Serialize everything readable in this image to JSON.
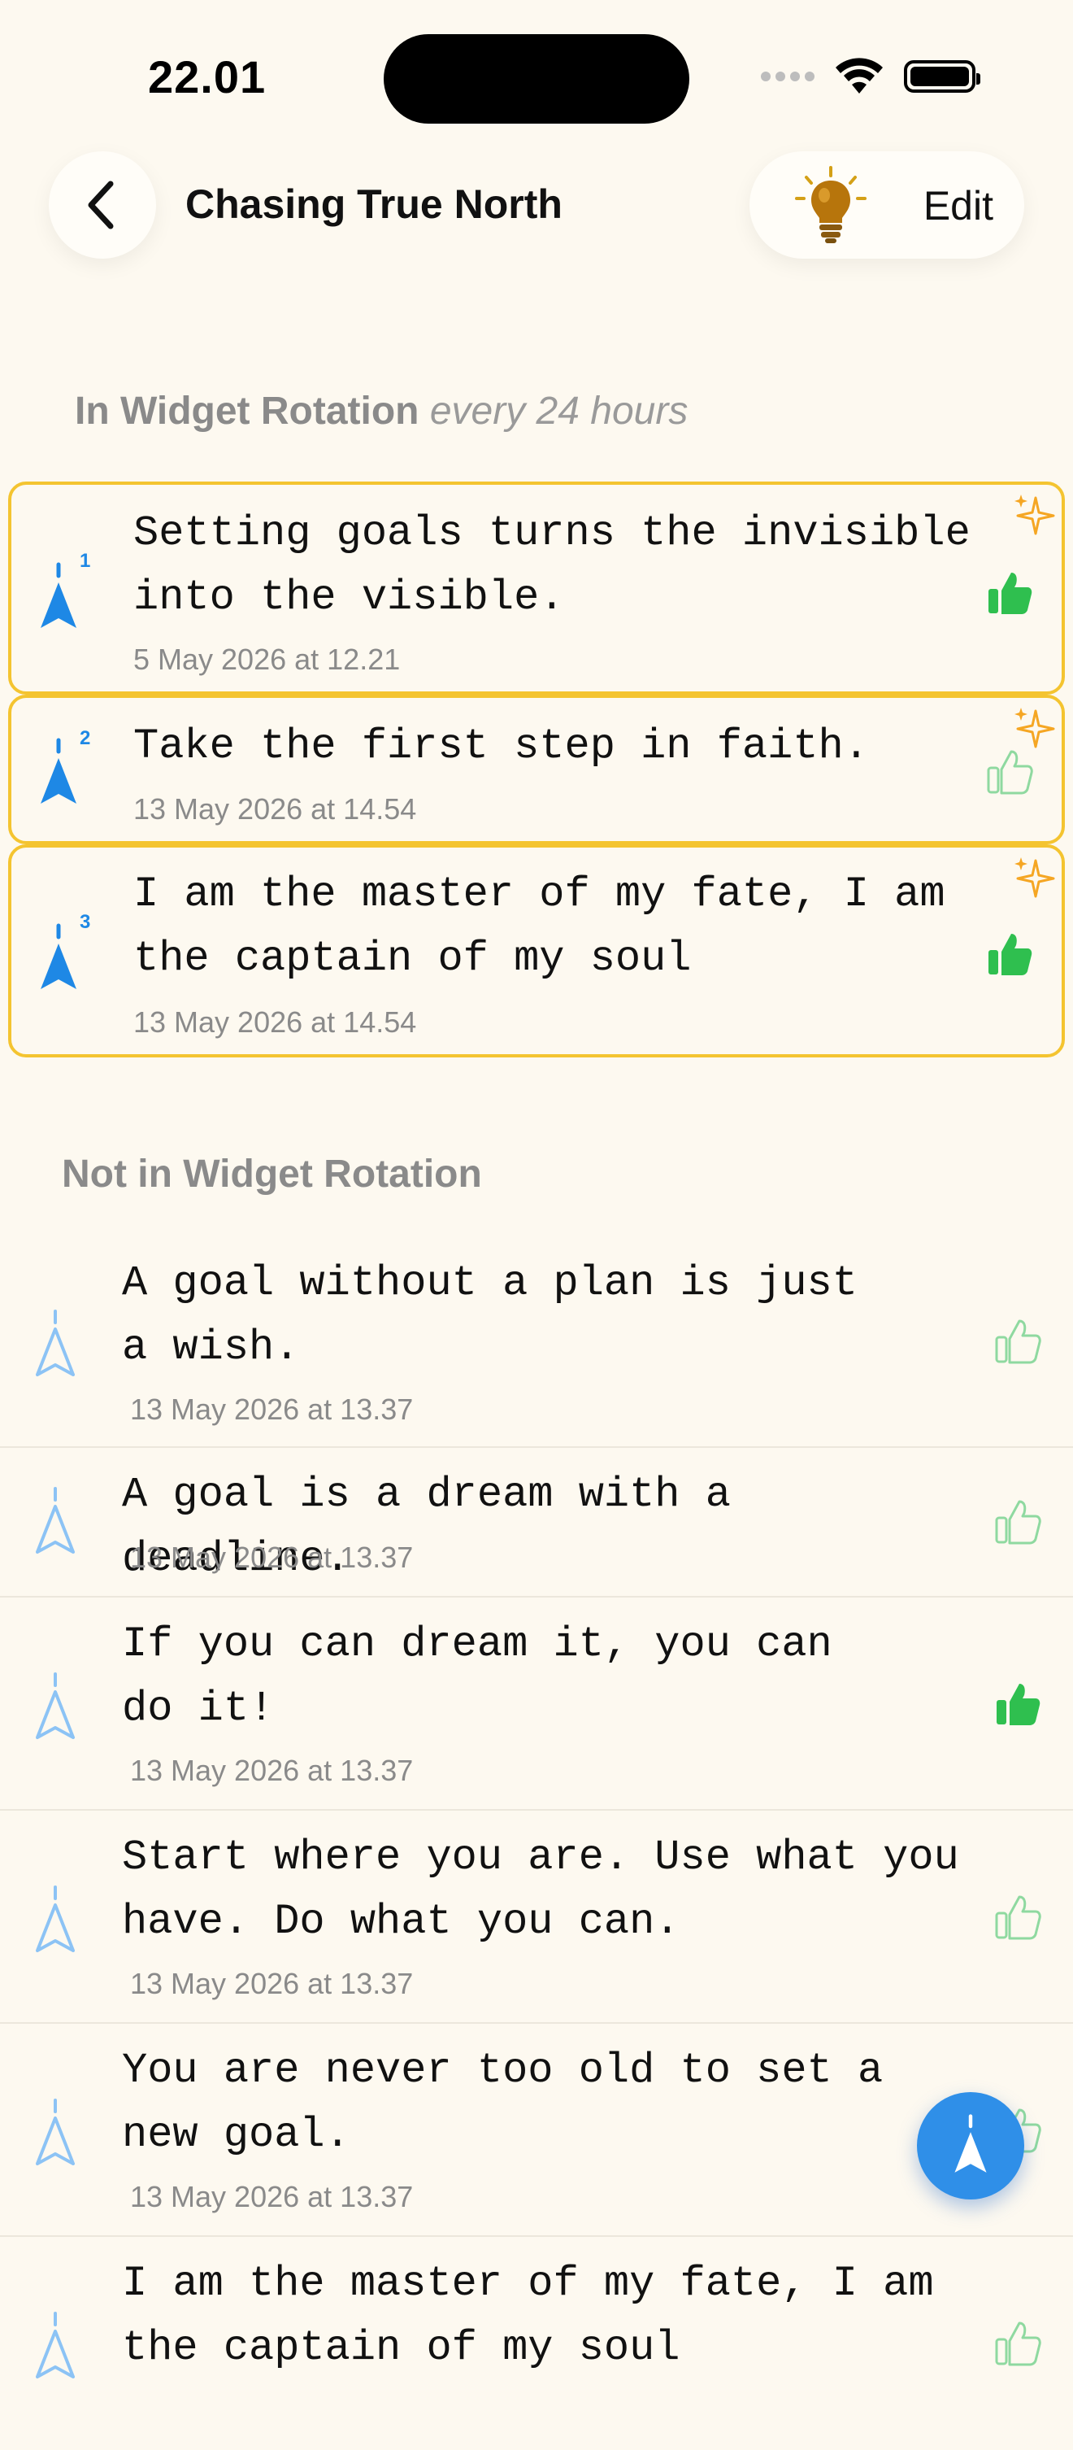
{
  "status_bar": {
    "time": "22.01"
  },
  "nav": {
    "title": "Chasing True North",
    "edit_label": "Edit"
  },
  "rotation_section": {
    "title": "In Widget Rotation",
    "subtitle": "every 24 hours",
    "items": [
      {
        "rank": "1",
        "text": "Setting goals turns the invisible\ninto the visible.",
        "date": "5 May 2026 at 12.21",
        "liked": true
      },
      {
        "rank": "2",
        "text": "Take the first step in faith.",
        "date": "13 May 2026 at 14.54",
        "liked": false
      },
      {
        "rank": "3",
        "text": "I am the master of my fate, I am\nthe captain of my soul",
        "date": "13 May 2026 at 14.54",
        "liked": true
      }
    ]
  },
  "other_section": {
    "title": "Not in Widget Rotation",
    "items": [
      {
        "text": "A goal without a plan is just\na wish.",
        "date": "13 May 2026 at 13.37",
        "liked": false
      },
      {
        "text": "A goal is a dream with a deadline.",
        "date": "13 May 2026 at 13.37",
        "liked": false
      },
      {
        "text": "If you can dream it, you can\ndo it!",
        "date": "13 May 2026 at 13.37",
        "liked": true
      },
      {
        "text": "Start where you are. Use what you\nhave. Do what you can.",
        "date": "13 May 2026 at 13.37",
        "liked": false
      },
      {
        "text": "You are never too old to set a\nnew goal.",
        "date": "13 May 2026 at 13.37",
        "liked": false
      },
      {
        "text": "I am the master of my fate, I am\nthe captain of my soul",
        "date": "",
        "liked": false
      }
    ]
  },
  "icons": {
    "back": "chevron-left-icon",
    "idea": "lightbulb-icon",
    "row_marker": "compass-arrow-icon",
    "sparkle": "sparkles-icon",
    "like": "thumbs-up-icon",
    "fab": "compass-arrow-icon"
  },
  "colors": {
    "background": "#fdf9f0",
    "active_border": "#f4c430",
    "accent_blue": "#1e88e5",
    "like_green": "#2fbf4f",
    "sparkle_orange": "#f5a623",
    "fab_blue": "#2f8fe8"
  }
}
